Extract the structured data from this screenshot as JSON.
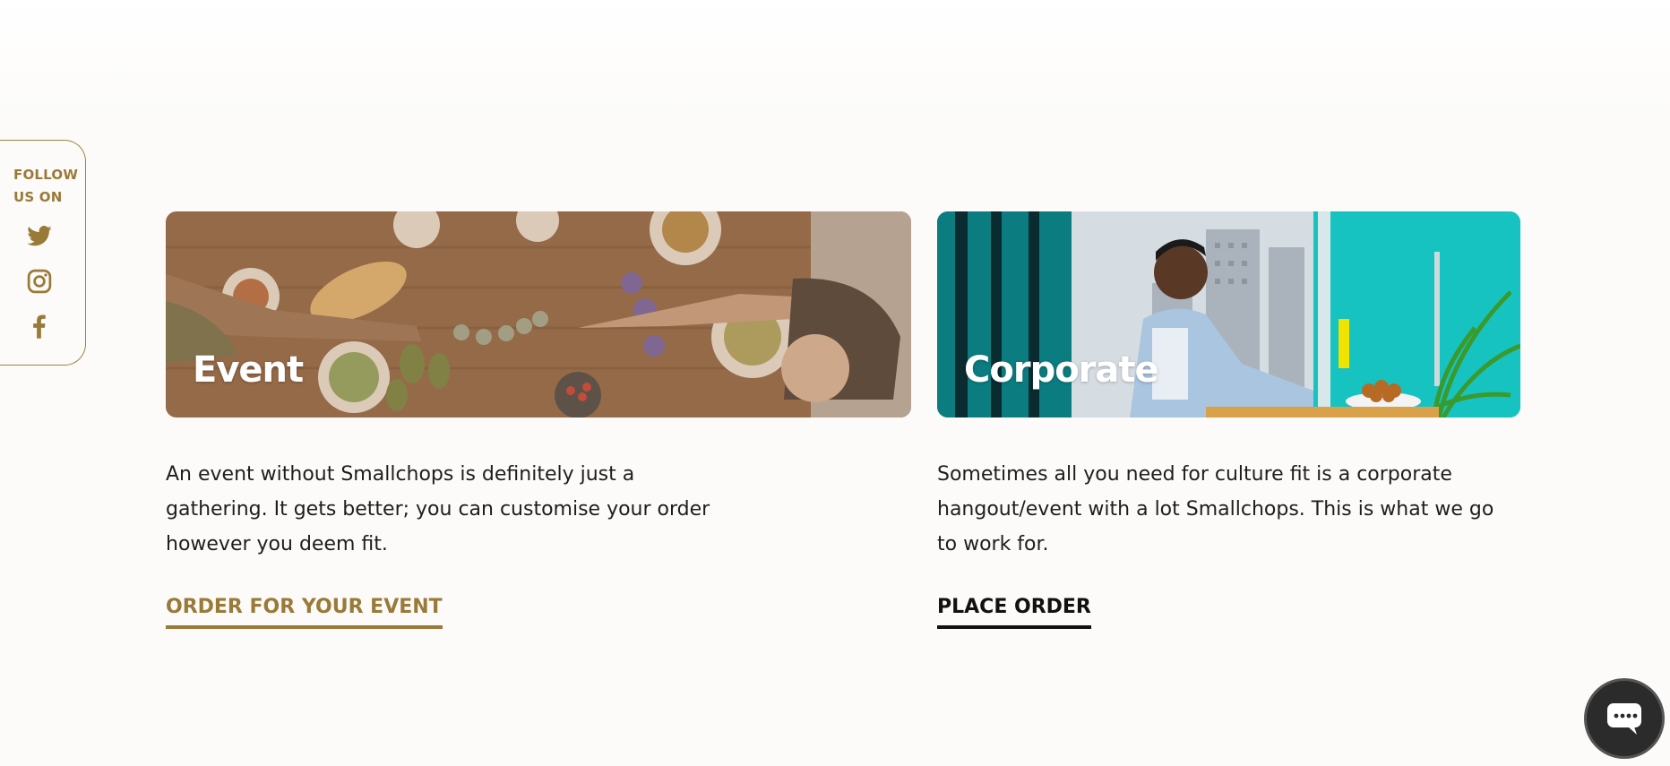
{
  "social": {
    "label": "FOLLOW US ON",
    "icons": [
      "twitter-icon",
      "instagram-icon",
      "facebook-icon"
    ],
    "color": "#9a7a39"
  },
  "cards": [
    {
      "title": "Event",
      "description": "An event without Smallchops is definitely just a gathering. It gets better; you can customise your order however you deem fit.",
      "link": "ORDER FOR YOUR EVENT",
      "link_color": "#9a7a39"
    },
    {
      "title": "Corporate",
      "description": "Sometimes all you need for culture fit is a corporate hangout/event with a lot Smallchops. This is what we go to work for.",
      "link": "PLACE ORDER",
      "link_color": "#111111"
    }
  ],
  "chat": {
    "icon": "chat-bubble-icon"
  }
}
